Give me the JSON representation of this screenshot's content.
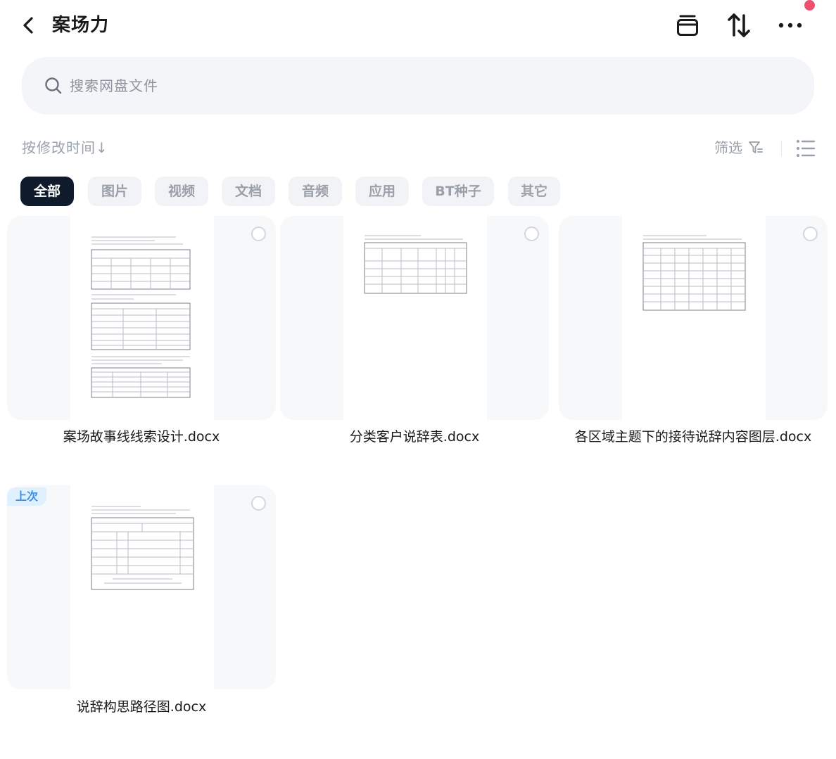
{
  "header": {
    "title": "案场力",
    "icons": [
      "chevron-left-icon",
      "archive-icon",
      "sort-arrows-icon",
      "more-horizontal-icon"
    ],
    "notification_dot_color": "#f0506e"
  },
  "search": {
    "placeholder": "搜索网盘文件",
    "icon": "search-icon"
  },
  "toolbar": {
    "sort_label": "按修改时间",
    "sort_arrow": "↓",
    "filter_label": "筛选",
    "filter_icon": "filter-icon",
    "view_icon": "list-view-icon"
  },
  "categories": {
    "active_color": "#0f1a2a",
    "items": [
      "全部",
      "图片",
      "视频",
      "文档",
      "音频",
      "应用",
      "BT种子",
      "其它"
    ],
    "selected": "全部"
  },
  "files": [
    {
      "name": "案场故事线线索设计.docx",
      "badge": ""
    },
    {
      "name": "分类客户说辞表.docx",
      "badge": ""
    },
    {
      "name": "各区域主题下的接待说辞内容图层.docx",
      "badge": ""
    },
    {
      "name": "说辞构思路径图.docx",
      "badge": "上次"
    }
  ]
}
